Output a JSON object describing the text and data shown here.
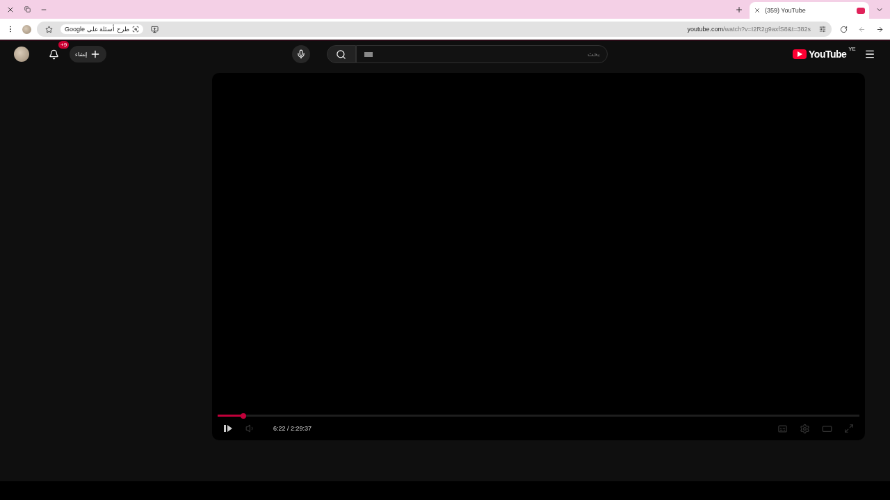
{
  "browser": {
    "tab_title": "(359) YouTube",
    "url_host": "youtube.com",
    "url_path": "/watch?v=I2R2g9axfS8&t=382s",
    "lens_chip": "طرح أسئلة على Google"
  },
  "header": {
    "notification_badge": "+9",
    "create_label": "إنشاء",
    "search": {
      "placeholder": "بحث"
    },
    "logo": "YouTube",
    "country": "YE"
  },
  "player": {
    "time": "6:22 / 2:29:37"
  }
}
